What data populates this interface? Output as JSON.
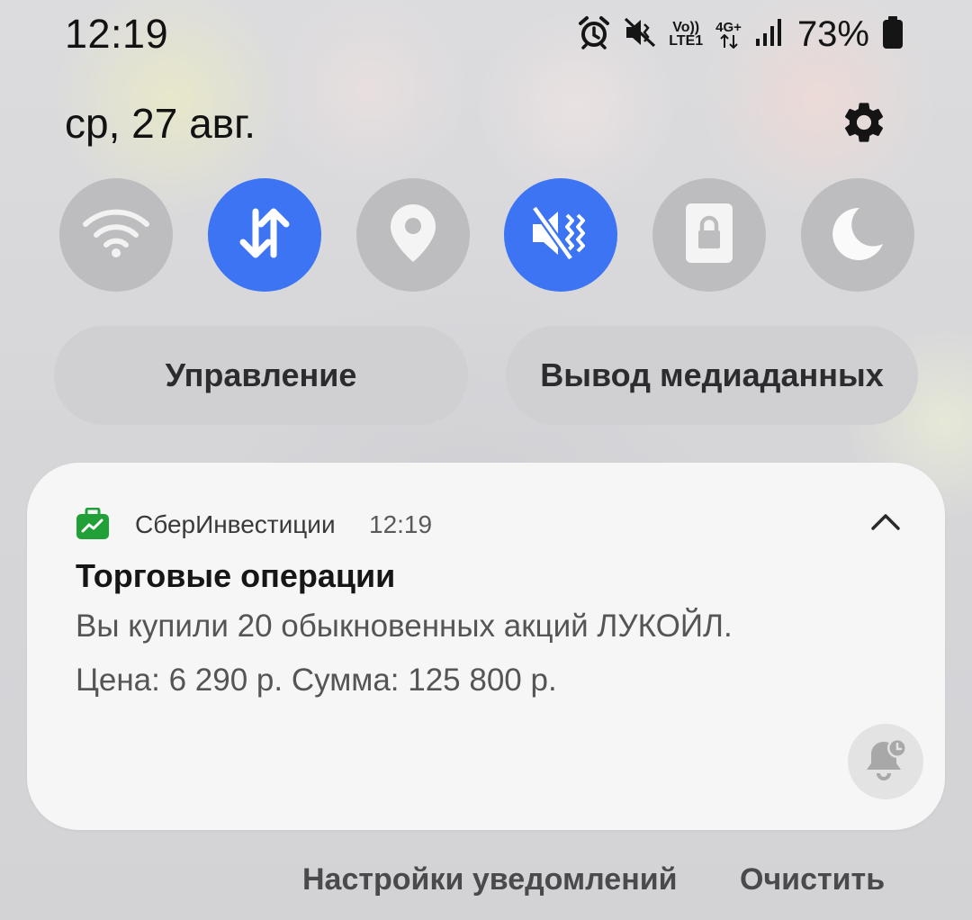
{
  "status_bar": {
    "time": "12:19",
    "battery_percent": "73%",
    "icons": [
      "alarm-icon",
      "mute-icon",
      "volte-lte1-icon",
      "4g-plus-data-icon",
      "signal-icon",
      "battery-icon"
    ],
    "volte_label_top": "Vo))",
    "volte_label_bottom": "LTE1",
    "network_label": "4G+"
  },
  "header": {
    "date": "ср, 27 авг.",
    "settings_icon": "gear-icon"
  },
  "quick_settings": {
    "accent_color": "#3c74f3",
    "tiles": [
      {
        "icon": "wifi-icon",
        "active": false
      },
      {
        "icon": "mobile-data-icon",
        "active": true
      },
      {
        "icon": "location-icon",
        "active": false
      },
      {
        "icon": "sound-mute-icon",
        "active": true
      },
      {
        "icon": "lock-rotation-icon",
        "active": false
      },
      {
        "icon": "night-mode-icon",
        "active": false
      }
    ]
  },
  "buttons": {
    "control": "Управление",
    "media_output": "Вывод медиаданных"
  },
  "notification": {
    "app_name": "СберИнвестиции",
    "time": "12:19",
    "title": "Торговые операции",
    "line1": "Вы купили 20 обыкновенных акций ЛУКОЙЛ.",
    "line2": "Цена: 6 290 р. Сумма: 125 800 р.",
    "app_color": "#21a038"
  },
  "footer": {
    "notification_settings": "Настройки уведомлений",
    "clear": "Очистить"
  }
}
